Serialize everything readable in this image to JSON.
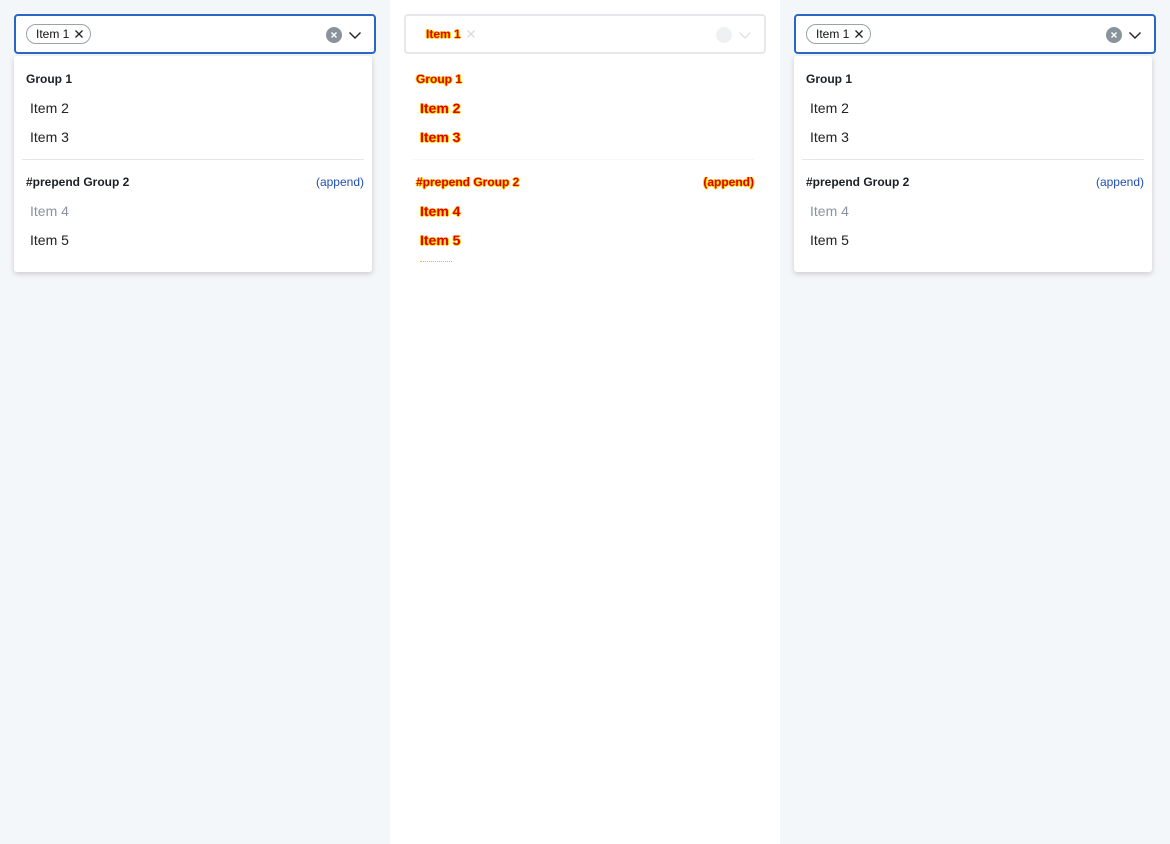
{
  "colors": {
    "accent_border": "#2a66c4",
    "append_link": "#1f4fb6",
    "disabled_text": "#8a949e",
    "background": "#f4f7fa"
  },
  "panels": [
    {
      "chip_label": "Item 1",
      "group1_label": "Group 1",
      "items_group1": [
        "Item 2",
        "Item 3"
      ],
      "group2_label": "#prepend Group 2",
      "group2_append": "(append)",
      "item4": "Item 4",
      "item5": "Item 5"
    },
    {
      "chip_label": "Item 1",
      "group1_label": "Group 1",
      "items_group1": [
        "Item 2",
        "Item 3"
      ],
      "group2_label": "#prepend Group 2",
      "group2_append": "(append)",
      "item4": "Item 4",
      "item5": "Item 5"
    },
    {
      "chip_label": "Item 1",
      "group1_label": "Group 1",
      "items_group1": [
        "Item 2",
        "Item 3"
      ],
      "group2_label": "#prepend Group 2",
      "group2_append": "(append)",
      "item4": "Item 4",
      "item5": "Item 5"
    }
  ]
}
